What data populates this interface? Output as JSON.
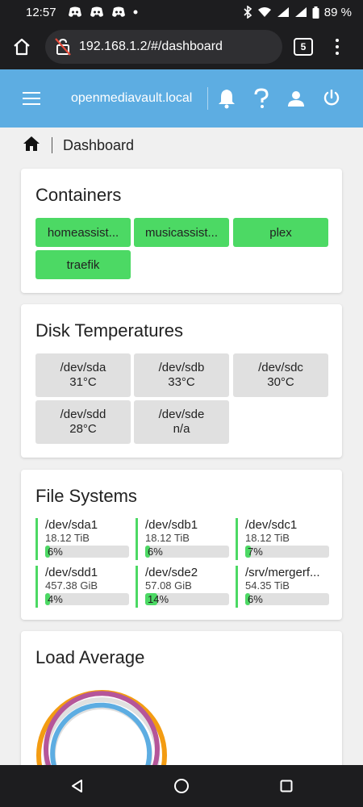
{
  "statusbar": {
    "time": "12:57",
    "battery": "89 %"
  },
  "browser": {
    "url": "192.168.1.2/#/dashboard",
    "tab_count": "5"
  },
  "appbar": {
    "hostname": "openmediavault.local"
  },
  "breadcrumb": {
    "current": "Dashboard"
  },
  "containers": {
    "title": "Containers",
    "items": [
      {
        "label": "homeassist...",
        "status": "running"
      },
      {
        "label": "musicassist...",
        "status": "running"
      },
      {
        "label": "plex",
        "status": "running"
      },
      {
        "label": "traefik",
        "status": "running"
      }
    ]
  },
  "disk_temperatures": {
    "title": "Disk Temperatures",
    "items": [
      {
        "device": "/dev/sda",
        "temp": "31°C"
      },
      {
        "device": "/dev/sdb",
        "temp": "33°C"
      },
      {
        "device": "/dev/sdc",
        "temp": "30°C"
      },
      {
        "device": "/dev/sdd",
        "temp": "28°C"
      },
      {
        "device": "/dev/sde",
        "temp": "n/a"
      }
    ]
  },
  "file_systems": {
    "title": "File Systems",
    "items": [
      {
        "device": "/dev/sda1",
        "size": "18.12 TiB",
        "usage": "6%",
        "usage_value": 6
      },
      {
        "device": "/dev/sdb1",
        "size": "18.12 TiB",
        "usage": "6%",
        "usage_value": 6
      },
      {
        "device": "/dev/sdc1",
        "size": "18.12 TiB",
        "usage": "7%",
        "usage_value": 7
      },
      {
        "device": "/dev/sdd1",
        "size": "457.38 GiB",
        "usage": "4%",
        "usage_value": 4
      },
      {
        "device": "/dev/sde2",
        "size": "57.08 GiB",
        "usage": "14%",
        "usage_value": 14
      },
      {
        "device": "/srv/mergerf...",
        "size": "54.35 TiB",
        "usage": "6%",
        "usage_value": 6
      }
    ]
  },
  "load_average": {
    "title": "Load Average",
    "colors": {
      "outer": "#f39c12",
      "middle": "#b5569a",
      "inner": "#5dade2",
      "track": "#e0e0e0"
    }
  },
  "colors": {
    "accent": "#5dade2",
    "success": "#4cd964",
    "neutral": "#e0e0e0"
  }
}
